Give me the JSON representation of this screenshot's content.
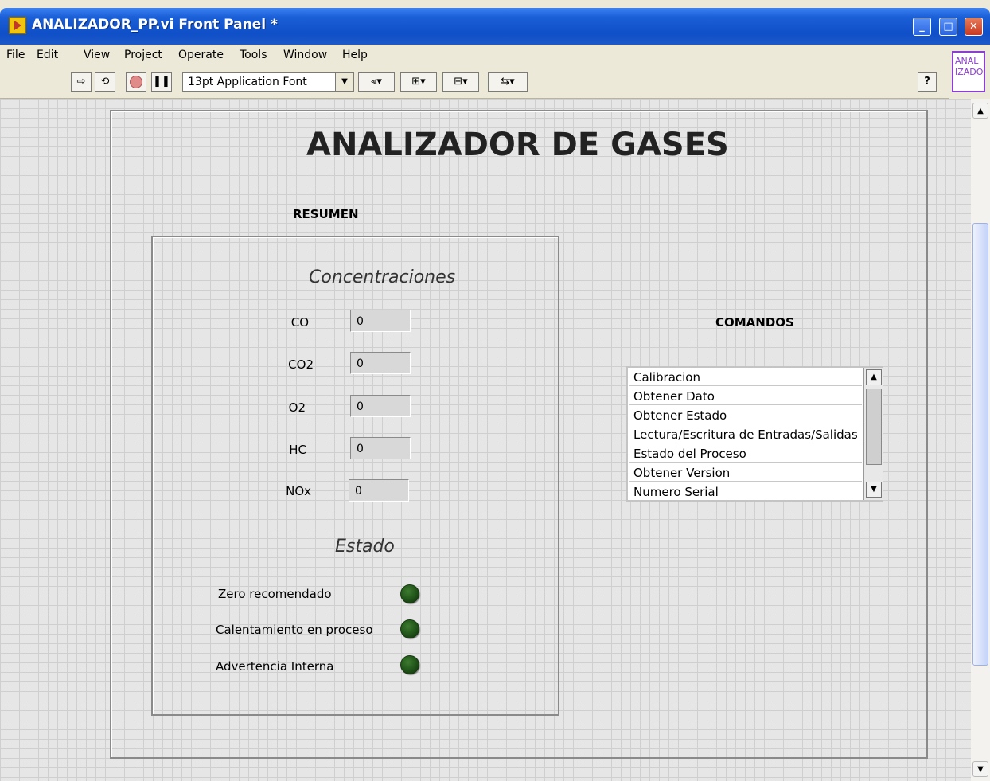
{
  "window": {
    "title": "ANALIZADOR_PP.vi Front Panel *",
    "controls": {
      "minimize": "_",
      "maximize": "□",
      "close": "✕"
    }
  },
  "menu": [
    "File",
    "Edit",
    "View",
    "Project",
    "Operate",
    "Tools",
    "Window",
    "Help"
  ],
  "toolbar": {
    "font": "13pt Application Font",
    "run_icon": "run-arrow-icon",
    "run_continuous_icon": "run-continuous-icon",
    "abort_icon": "abort-icon",
    "pause_icon": "pause-icon",
    "help_label": "?"
  },
  "vi_icon": {
    "line1": "ANAL",
    "line2": "IZADO"
  },
  "panel": {
    "title": "ANALIZADOR DE GASES",
    "resumen_label": "RESUMEN",
    "concentraciones_heading": "Concentraciones",
    "indicators": [
      {
        "label": "CO",
        "value": "0"
      },
      {
        "label": "CO2",
        "value": "0"
      },
      {
        "label": "O2",
        "value": "0"
      },
      {
        "label": "HC",
        "value": "0"
      },
      {
        "label": "NOx",
        "value": "0"
      }
    ],
    "estado_heading": "Estado",
    "leds": [
      {
        "label": "Zero recomendado",
        "on": false
      },
      {
        "label": "Calentamiento en proceso",
        "on": false
      },
      {
        "label": "Advertencia Interna",
        "on": false
      }
    ],
    "comandos_label": "COMANDOS",
    "commands": [
      "Calibracion",
      "Obtener Dato",
      "Obtener Estado",
      "Lectura/Escritura de Entradas/Salidas",
      "Estado del Proceso",
      "Obtener Version",
      "Numero Serial"
    ]
  },
  "colors": {
    "led_off": "#245a1c",
    "title_bar": "#0f4fc8",
    "vi_icon_border": "#8b3fcf"
  }
}
